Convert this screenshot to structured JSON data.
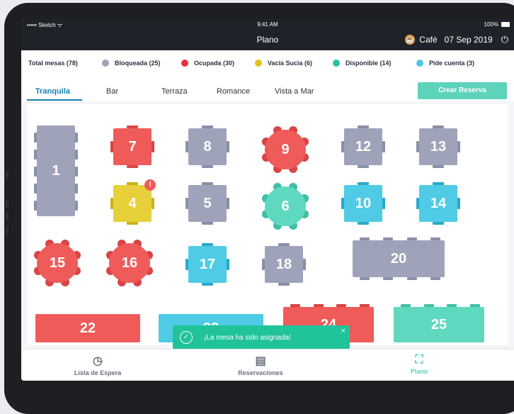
{
  "status_bar": {
    "carrier": "••••• Sketch ᯤ",
    "time": "9:41 AM",
    "battery": "100%"
  },
  "nav": {
    "title": "Plano",
    "venue": "Café",
    "date": "07 Sep 2019",
    "venue_icon": "coffee-icon",
    "power_icon": "power-icon"
  },
  "legend": [
    {
      "label": "Total mesas (78)",
      "color": ""
    },
    {
      "label": "Bloqueada (25)",
      "color": "#9fa3ba"
    },
    {
      "label": "Ocupada (30)",
      "color": "#e8303a"
    },
    {
      "label": "Vacía Sucia (6)",
      "color": "#e0c020"
    },
    {
      "label": "Disponible (14)",
      "color": "#27c3a0"
    },
    {
      "label": "Pide cuenta (3)",
      "color": "#4bc8e6"
    }
  ],
  "tabs": [
    "Tranquila",
    "Bar",
    "Terraza",
    "Romance",
    "Vista a Mar"
  ],
  "active_tab": "Tranquila",
  "reserve_button": "Crear Reserva",
  "tables": [
    {
      "num": "1",
      "status": "blocked"
    },
    {
      "num": "4",
      "status": "dirty",
      "alert": "!"
    },
    {
      "num": "5",
      "status": "blocked"
    },
    {
      "num": "6",
      "status": "available"
    },
    {
      "num": "7",
      "status": "occupied"
    },
    {
      "num": "8",
      "status": "blocked"
    },
    {
      "num": "9",
      "status": "occupied"
    },
    {
      "num": "10",
      "status": "check"
    },
    {
      "num": "12",
      "status": "blocked"
    },
    {
      "num": "13",
      "status": "blocked"
    },
    {
      "num": "14",
      "status": "check"
    },
    {
      "num": "15",
      "status": "occupied"
    },
    {
      "num": "16",
      "status": "occupied"
    },
    {
      "num": "17",
      "status": "check"
    },
    {
      "num": "18",
      "status": "blocked"
    },
    {
      "num": "20",
      "status": "blocked"
    },
    {
      "num": "22",
      "status": "occupied"
    },
    {
      "num": "23",
      "status": "check"
    },
    {
      "num": "24",
      "status": "occupied"
    },
    {
      "num": "25",
      "status": "available"
    }
  ],
  "toast": {
    "message": "¡La mesa ha sido asignada!",
    "close": "×",
    "icon": "check-circle-icon"
  },
  "bottom_nav": [
    {
      "label": "Lista de Espera",
      "icon": "clock-icon"
    },
    {
      "label": "Reservaciones",
      "icon": "clipboard-icon"
    },
    {
      "label": "Plano",
      "icon": "map-icon",
      "active": true
    }
  ],
  "colors": {
    "blocked": "#9fa3ba",
    "occupied": "#ef5b59",
    "dirty": "#e8d03a",
    "available": "#5fd8c0",
    "check": "#4fcbe6",
    "accent": "#5dd3bb",
    "tab_active": "#1a7fb5"
  }
}
